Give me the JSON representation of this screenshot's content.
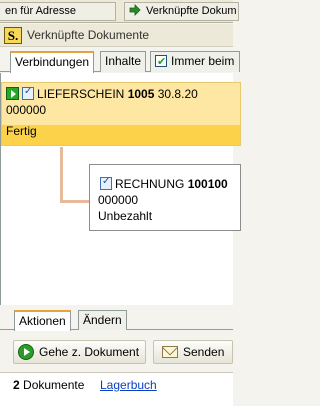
{
  "top_tabs": [
    {
      "label": "en für Adresse"
    },
    {
      "label": "Verknüpfte Dokum"
    }
  ],
  "window": {
    "title": "Verknüpfte Dokumente",
    "logo": "S."
  },
  "view_tabs": {
    "connections": "Verbindungen",
    "contents": "Inhalte",
    "always_label": "Immer beim"
  },
  "documents": [
    {
      "type": "LIEFERSCHEIN",
      "number": "1005",
      "date": "30.8.20",
      "code": "000000",
      "status": "Fertig"
    },
    {
      "type": "RECHNUNG",
      "number": "100100",
      "code": "000000",
      "status": "Unbezahlt"
    }
  ],
  "bottom_tabs": {
    "actions": "Aktionen",
    "change": "Ändern"
  },
  "actions": {
    "goto_doc": "Gehe z. Dokument",
    "send": "Senden"
  },
  "status": {
    "count": "2",
    "count_label": "Dokumente",
    "link": "Lagerbuch"
  },
  "icons": [
    "arrow-icon",
    "logo-icon",
    "checkbox-icon",
    "play-icon",
    "document-icon",
    "go-icon",
    "mail-icon"
  ],
  "colors": {
    "card_highlight": "#fde7a2",
    "card_stripe": "#fcd24a",
    "active_tab_accent": "#e6a23c",
    "connector": "#e8b99a",
    "link": "#0b3fc2"
  }
}
